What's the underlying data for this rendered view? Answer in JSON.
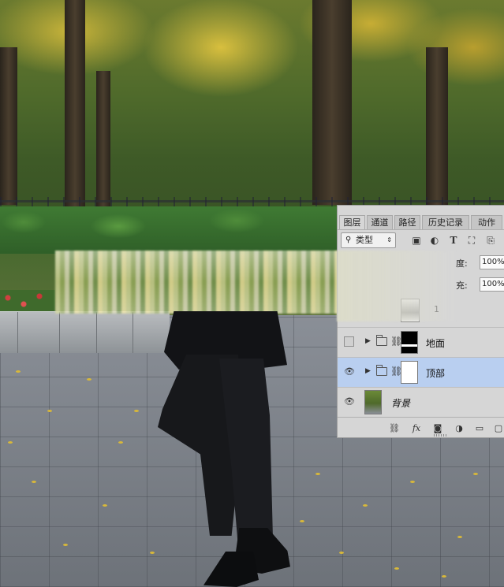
{
  "panel": {
    "tabs": [
      "图层",
      "通道",
      "路径",
      "历史记录",
      "动作"
    ],
    "active_tab": "图层",
    "filter_select": {
      "label": "类型"
    },
    "toolbar_icons": [
      "image-filter-icon",
      "adjustment-filter-icon",
      "text-filter-icon",
      "shape-filter-icon",
      "smart-object-filter-icon"
    ],
    "opacity": {
      "label": "度:",
      "value": "100%"
    },
    "fill": {
      "label": "充:",
      "value": "100%"
    },
    "partial_layer_name": "1",
    "layers": [
      {
        "name": "地面",
        "visible": false,
        "type": "group",
        "selected": false
      },
      {
        "name": "顶部",
        "visible": true,
        "type": "group",
        "selected": true
      },
      {
        "name": "背景",
        "visible": true,
        "type": "image",
        "selected": false
      }
    ],
    "bottom_icons": [
      "link-layers-icon",
      "fx-icon",
      "add-mask-icon",
      "adjustment-layer-icon",
      "new-group-icon",
      "new-layer-icon"
    ],
    "selected_color": "#b9cff0"
  }
}
